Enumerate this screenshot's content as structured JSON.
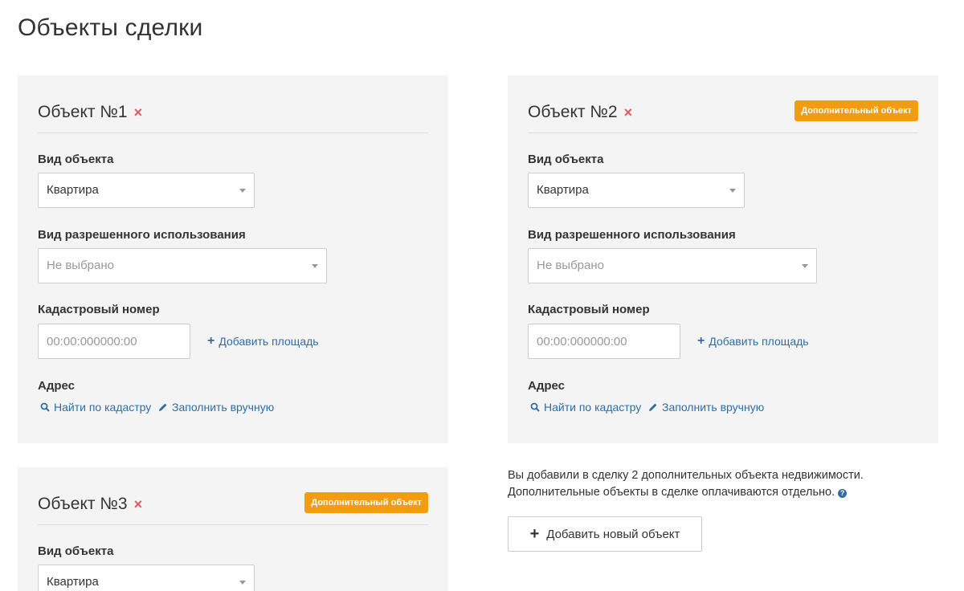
{
  "page": {
    "title": "Объекты сделки"
  },
  "objects": [
    {
      "title": "Объект №1",
      "remove": "×",
      "badge": "",
      "type_label": "Вид объекта",
      "type_value": "Квартира",
      "usage_label": "Вид разрешенного использования",
      "usage_value": "Не выбрано",
      "cadastral_label": "Кадастровый номер",
      "cadastral_placeholder": "00:00:000000:00",
      "add_area": "Добавить площадь",
      "address_label": "Адрес",
      "find_by_cadastre": "Найти по кадастру",
      "fill_manually": "Заполнить вручную"
    },
    {
      "title": "Объект №2",
      "remove": "×",
      "badge": "Дополнительный объект",
      "type_label": "Вид объекта",
      "type_value": "Квартира",
      "usage_label": "Вид разрешенного использования",
      "usage_value": "Не выбрано",
      "cadastral_label": "Кадастровый номер",
      "cadastral_placeholder": "00:00:000000:00",
      "add_area": "Добавить площадь",
      "address_label": "Адрес",
      "find_by_cadastre": "Найти по кадастру",
      "fill_manually": "Заполнить вручную"
    },
    {
      "title": "Объект №3",
      "remove": "×",
      "badge": "Дополнительный объект",
      "type_label": "Вид объекта",
      "type_value": "Квартира"
    }
  ],
  "info": {
    "line1": "Вы добавили в сделку 2 дополнительных объекта недвижимости.",
    "line2": "Дополнительные объекты в сделке оплачиваются отдельно.",
    "help": "?"
  },
  "add_button": {
    "plus": "+",
    "label": "Добавить новый объект"
  },
  "colors": {
    "accent_orange": "#f39c12",
    "link_blue": "#2f6da6",
    "remove_red": "#e05a5a",
    "card_bg": "#f4f4f4"
  }
}
